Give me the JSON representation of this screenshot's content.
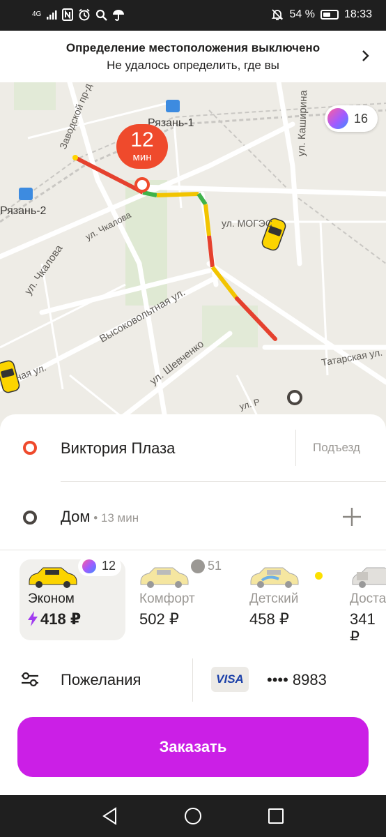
{
  "status_bar": {
    "network": "4G",
    "battery": "54 %",
    "battery_level": 0.54,
    "time": "18:33"
  },
  "location_banner": {
    "title": "Определение местоположения выключено",
    "subtitle": "Не удалось определить, где вы"
  },
  "map": {
    "eta_value": "12",
    "eta_unit": "мин",
    "plus_points": "16",
    "streets": [
      "Заводской пр-д",
      "ул. Каширина",
      "ул. Чкалова",
      "ул. Чкалова",
      "ул. МОГЭС",
      "Высоковольтная ул.",
      "ул. Шевченко",
      "Татарская ул.",
      "ная ул.",
      "ул. Р"
    ],
    "stations": [
      "Рязань-1",
      "Рязань-2"
    ]
  },
  "route": {
    "pickup": "Виктория Плаза",
    "entrance": "Подъезд",
    "destination": "Дом",
    "destination_eta": "13 мин"
  },
  "tariffs": [
    {
      "name": "Эконом",
      "price": "418 ₽",
      "badge": "12",
      "selected": true
    },
    {
      "name": "Комфорт",
      "price": "502 ₽",
      "badge": "51",
      "selected": false
    },
    {
      "name": "Детский",
      "price": "458 ₽",
      "badge": "",
      "selected": false
    },
    {
      "name": "Доста",
      "price": "341 ₽",
      "badge": "",
      "selected": false
    }
  ],
  "options": {
    "preferences_label": "Пожелания",
    "card_brand": "VISA",
    "card_number": "•••• 8983"
  },
  "order_button": "Заказать",
  "colors": {
    "accent": "#cb1fe6",
    "pickup": "#ef4a2c",
    "taxi_yellow": "#fce000"
  }
}
